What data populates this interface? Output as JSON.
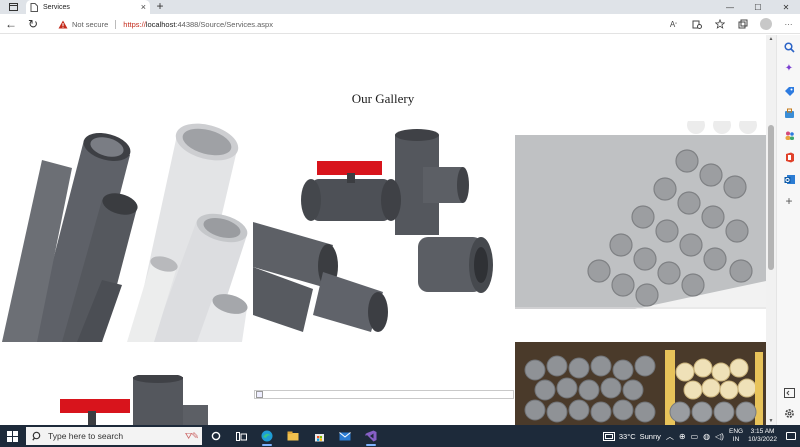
{
  "browser": {
    "tab": {
      "title": "Services",
      "close": "×"
    },
    "new_tab": "+",
    "window_controls": {
      "minimize": "—",
      "maximize": "☐",
      "close": "✕"
    },
    "nav": {
      "back": "←",
      "refresh": "↻"
    },
    "address": {
      "security_label": "Not secure",
      "url_scheme": "https://",
      "url_host": "localhost",
      "url_rest": ":44388/Source/Services.aspx"
    },
    "toolbar_icons": [
      "read-aloud-icon",
      "tracking-prevention-icon",
      "favorites-star-icon",
      "collections-icon",
      "profile-icon",
      "more-icon"
    ]
  },
  "page": {
    "gallery_title": "Our Gallery",
    "images": [
      {
        "name": "gallery-image-grey-white-pipes"
      },
      {
        "name": "gallery-image-ball-valve-fittings"
      },
      {
        "name": "gallery-image-grey-pipe-stack"
      },
      {
        "name": "gallery-image-valve-second"
      },
      {
        "name": "gallery-image-broken"
      },
      {
        "name": "gallery-image-pipe-warehouse"
      }
    ]
  },
  "sidebar": {
    "icons": [
      "search-icon",
      "copilot-icon",
      "shopping-tag-icon",
      "tools-icon",
      "people-icon",
      "office-icon",
      "outlook-icon",
      "add-icon",
      "hide-sidebar-icon",
      "settings-icon"
    ]
  },
  "taskbar": {
    "search_placeholder": "Type here to search",
    "weather_temp": "33°C",
    "weather_desc": "Sunny",
    "lang_line1": "ENG",
    "lang_line2": "IN",
    "time": "3:15 AM",
    "date": "10/3/2022"
  },
  "colors": {
    "taskbar_bg": "#1d2a3a",
    "warning_red": "#c42b1c",
    "tab_strip_bg": "#dfe3e8"
  }
}
